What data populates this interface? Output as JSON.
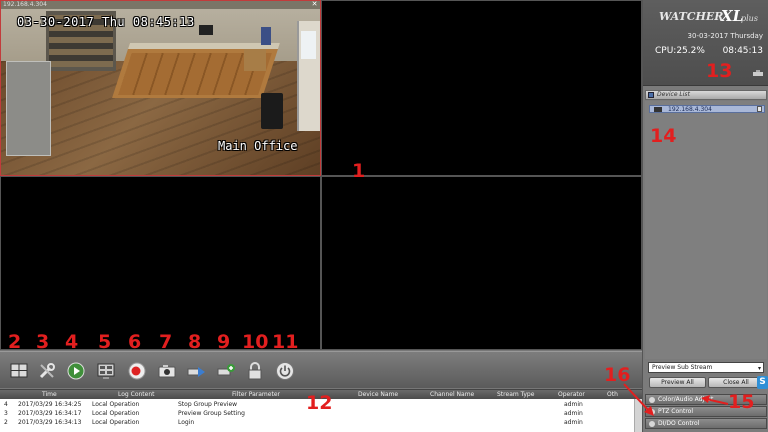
{
  "cell1": {
    "tag": "192.168.4.304",
    "timestamp": "03-30-2017 Thu 08:45:13",
    "camera_name": "Main Office"
  },
  "toolbar": {
    "icons": [
      "layout-icon",
      "tools-icon",
      "playback-icon",
      "multi-screen-icon",
      "record-icon",
      "snapshot-icon",
      "transfer-icon",
      "add-device-icon",
      "lock-icon",
      "power-icon"
    ]
  },
  "log": {
    "columns": [
      "Time",
      "Log Content",
      "Filter Parameter",
      "Device Name",
      "Channel Name",
      "Stream Type",
      "Operator",
      "Oth"
    ],
    "rows": [
      {
        "n": "4",
        "time": "2017/03/29 16:34:25",
        "content": "Local Operation",
        "param": "Stop Group Preview",
        "operator": "admin"
      },
      {
        "n": "3",
        "time": "2017/03/29 16:34:17",
        "content": "Local Operation",
        "param": "Preview Group Setting",
        "operator": "admin"
      },
      {
        "n": "2",
        "time": "2017/03/29 16:34:13",
        "content": "Local Operation",
        "param": "Login",
        "operator": "admin"
      }
    ]
  },
  "brand": {
    "logo_main": "WATCHER",
    "logo_xl": "XL",
    "logo_plus": "plus",
    "date": "30-03-2017 Thursday",
    "cpu": "CPU:25.2%",
    "clock": "08:45:13"
  },
  "device_list": {
    "title": "Device List",
    "items": [
      "192.168.4.304"
    ]
  },
  "stream": {
    "selected": "Preview Sub Stream",
    "preview_all": "Preview All",
    "close_all": "Close All"
  },
  "accordion": {
    "color": "Color/Audio Adjust",
    "ptz": "PTZ Control",
    "dido": "DI/DO Control"
  },
  "annotations": [
    "1",
    "2",
    "3",
    "4",
    "5",
    "6",
    "7",
    "8",
    "9",
    "10",
    "11",
    "12",
    "13",
    "14",
    "15",
    "16"
  ],
  "colors": {
    "annotation": "#e21f1f",
    "selection": "#a9b8d8",
    "panel": "#7b7b7b"
  }
}
